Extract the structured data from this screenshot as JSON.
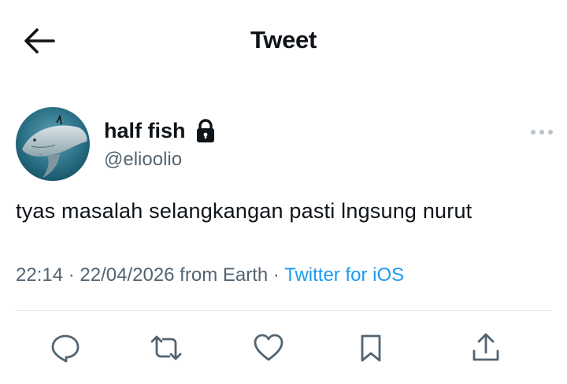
{
  "header": {
    "title": "Tweet",
    "back_icon": "arrow-left-icon"
  },
  "author": {
    "display_name": "half fish",
    "handle": "@elioolio",
    "protected_icon": "lock-icon",
    "avatar": "shark-photo-avatar"
  },
  "more_icon": "more-horizontal-icon",
  "tweet": {
    "text": "tyas masalah selangkangan pasti lngsung nurut"
  },
  "meta": {
    "time": "22:14",
    "sep1": " · ",
    "date": "22/04/2026",
    "location": " from Earth",
    "sep2": " · ",
    "source": "Twitter for iOS"
  },
  "actions": [
    {
      "name": "reply",
      "icon": "reply-icon"
    },
    {
      "name": "retweet",
      "icon": "retweet-icon"
    },
    {
      "name": "like",
      "icon": "heart-icon"
    },
    {
      "name": "bookmark",
      "icon": "bookmark-icon"
    },
    {
      "name": "share",
      "icon": "share-icon"
    }
  ],
  "colors": {
    "text": "#0f1419",
    "secondary": "#536471",
    "link": "#1d9bf0",
    "divider": "#e1e6ea"
  }
}
